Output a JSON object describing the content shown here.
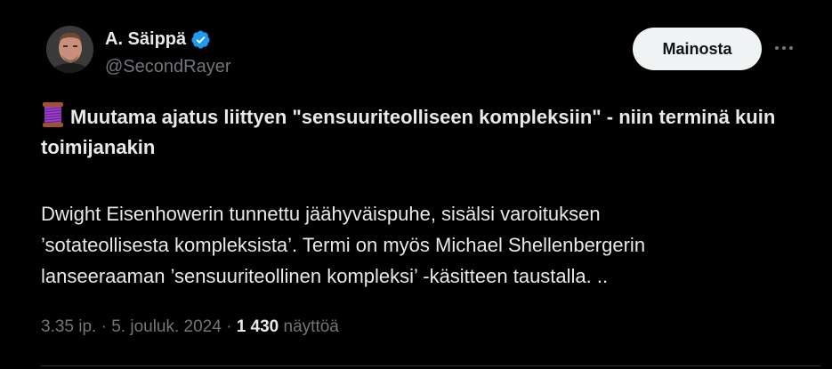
{
  "author": {
    "display_name": "A. Säippä",
    "handle": "@SecondRayer",
    "verified_icon": "verified-badge-icon",
    "avatar_icon": "profile-photo"
  },
  "actions": {
    "promote_label": "Mainosta",
    "more_icon": "more-horizontal-icon"
  },
  "post": {
    "emoji_icon": "thread-spool-emoji",
    "title": "Muutama ajatus liittyen \"sensuuriteolliseen kompleksiin\" - niin terminä kuin toimijanakin",
    "body_lines": [
      "Dwight Eisenhowerin tunnettu jäähyväispuhe, sisälsi varoituksen",
      "’sotateollisesta kompleksista’. Termi on myös Michael Shellenbergerin",
      "lanseeraaman ’sensuuriteollinen kompleksi’ -käsitteen taustalla. .."
    ]
  },
  "meta": {
    "time": "3.35 ip.",
    "separator1": " · ",
    "date": "5. jouluk. 2024",
    "separator2": " · ",
    "views_count": "1 430",
    "views_label": " näyttöä"
  },
  "colors": {
    "background": "#000000",
    "text_primary": "#e7e9ea",
    "text_secondary": "#71767b",
    "verified_blue": "#1d9bf0",
    "button_bg": "#eff3f4",
    "divider": "#2f3336"
  }
}
